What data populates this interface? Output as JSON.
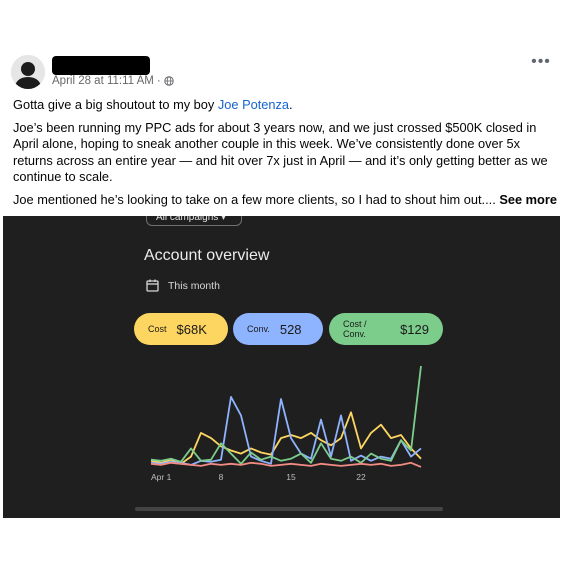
{
  "post": {
    "timestamp": "April 28 at 11:11 AM",
    "separator": "·",
    "more_label": "•••",
    "p1_prefix": "Gotta give a big shoutout to my boy ",
    "mention": "Joe Potenza",
    "p1_suffix": ".",
    "p2": "Joe’s been running my PPC ads for about 3 years now, and we just crossed $500K closed in April alone, hoping to sneak another couple in this week. We’ve consistently done over 5x returns across an entire year — and hit over 7x just in April — and it’s only getting better as we continue to scale.",
    "p3": "Joe mentioned he’s looking to take on a few more clients, so I had to shout him out....",
    "see_more": "See more"
  },
  "dashboard": {
    "campaign_filter": "All campaigns ▾",
    "title": "Account overview",
    "period": "This month",
    "metrics": [
      {
        "label": "Cost",
        "value": "$68K",
        "color": "#fdd661"
      },
      {
        "label": "Conv.",
        "value": "528",
        "color": "#8eb3ff"
      },
      {
        "label": "Cost / Conv.",
        "value": "$129",
        "color": "#7ccd8b"
      }
    ]
  },
  "chart_data": {
    "type": "line",
    "x": [
      1,
      2,
      3,
      4,
      5,
      6,
      7,
      8,
      9,
      10,
      11,
      12,
      13,
      14,
      15,
      16,
      17,
      18,
      19,
      20,
      21,
      22,
      23,
      24,
      25,
      26,
      27,
      28
    ],
    "xticks": [
      "Apr 1",
      "8",
      "15",
      "22"
    ],
    "xtick_values": [
      1,
      8,
      15,
      22
    ],
    "ylim": [
      0,
      100
    ],
    "grid": false,
    "series": [
      {
        "color": "#fdd661",
        "values": [
          8,
          6,
          9,
          5,
          12,
          35,
          30,
          22,
          18,
          15,
          20,
          16,
          14,
          30,
          33,
          30,
          35,
          28,
          23,
          30,
          55,
          20,
          35,
          43,
          30,
          33,
          20,
          10
        ]
      },
      {
        "color": "#8eb3ff",
        "values": [
          6,
          5,
          7,
          6,
          4,
          8,
          7,
          9,
          70,
          52,
          12,
          8,
          5,
          68,
          30,
          15,
          10,
          48,
          12,
          52,
          8,
          13,
          8,
          12,
          10,
          28,
          12,
          20
        ]
      },
      {
        "color": "#7ccd8b",
        "values": [
          9,
          8,
          10,
          7,
          20,
          8,
          9,
          25,
          15,
          5,
          16,
          9,
          12,
          8,
          10,
          15,
          6,
          25,
          10,
          8,
          12,
          6,
          15,
          10,
          8,
          28,
          18,
          100
        ]
      },
      {
        "color": "#f28b82",
        "values": [
          5,
          4,
          6,
          5,
          4,
          3,
          5,
          4,
          5,
          4,
          6,
          5,
          3,
          4,
          5,
          4,
          3,
          5,
          4,
          3,
          4,
          5,
          4,
          5,
          3,
          4,
          6,
          2
        ]
      }
    ]
  }
}
